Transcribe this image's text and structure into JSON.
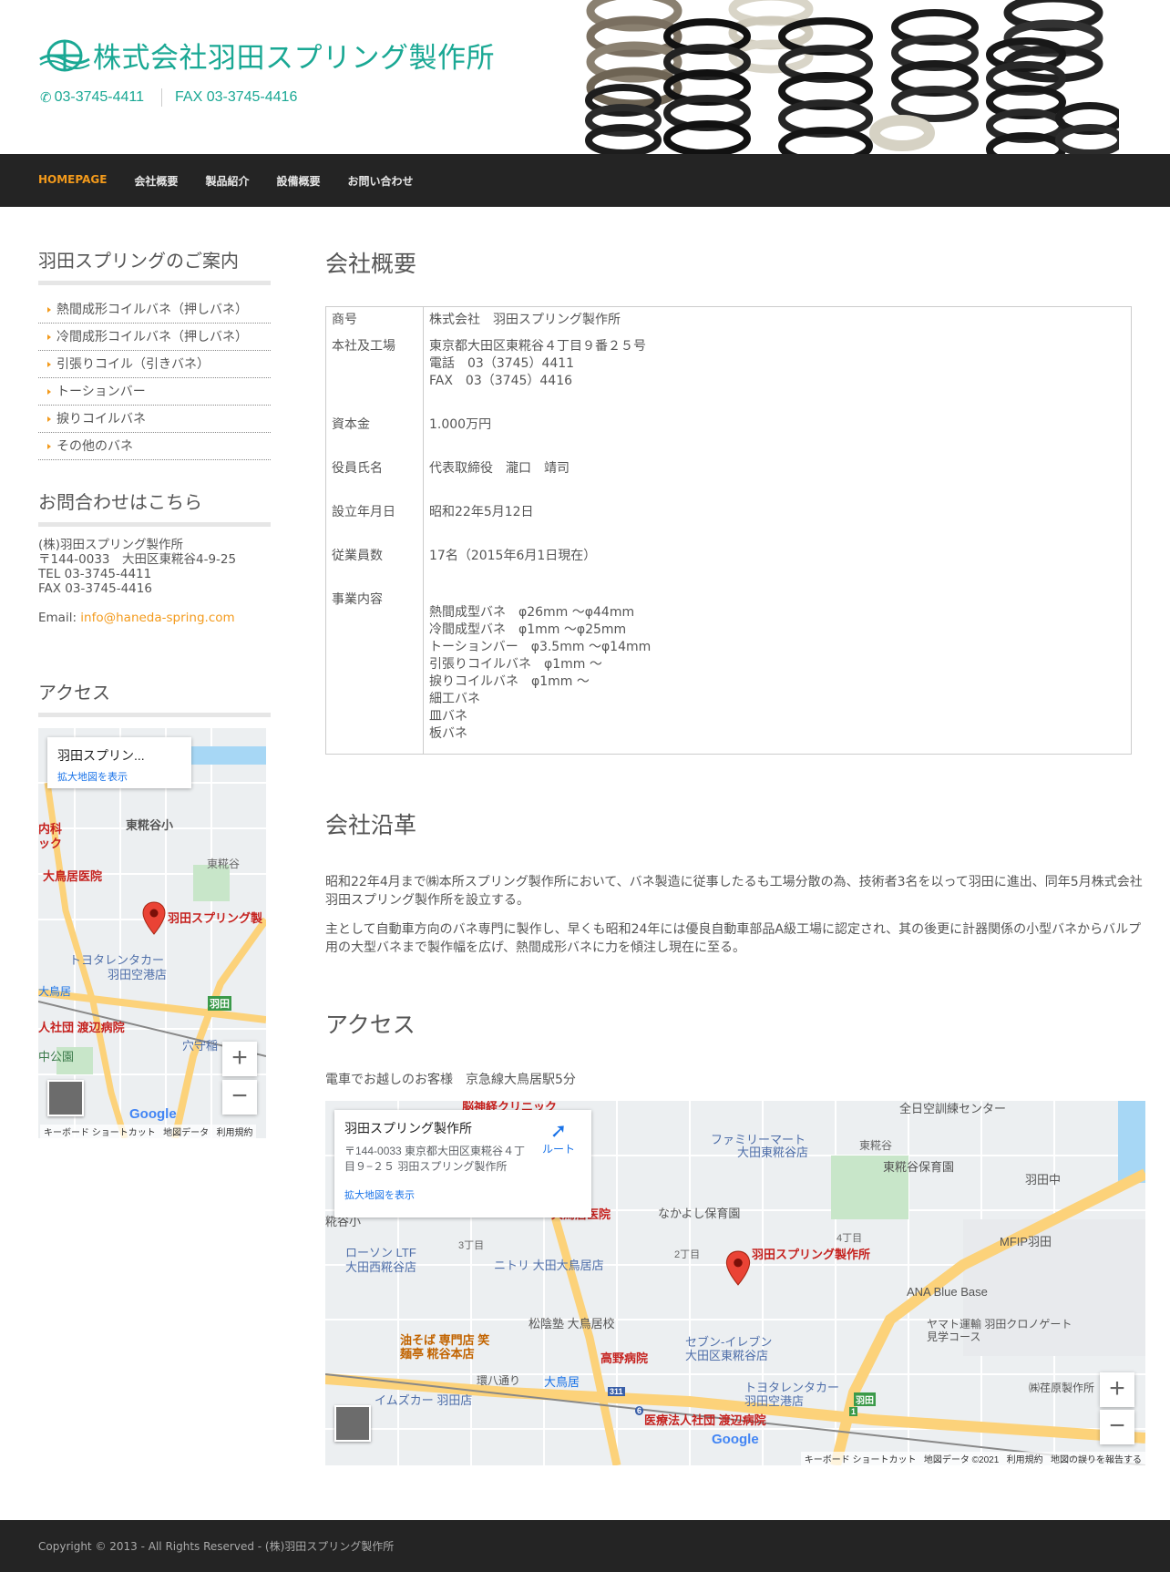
{
  "header": {
    "site_title": "株式会社羽田スプリング製作所",
    "phone": "03-3745-4411",
    "fax": "FAX 03-3745-4416"
  },
  "nav": {
    "items": [
      "HOMEPAGE",
      "会社概要",
      "製品紹介",
      "設備概要",
      "お問い合わせ"
    ]
  },
  "sidebar": {
    "guide_title": "羽田スプリングのご案内",
    "guide_items": [
      "熱間成形コイルバネ（押しバネ）",
      "冷間成形コイルバネ（押しバネ）",
      "引張りコイル（引きバネ）",
      "トーションバー",
      "捩りコイルバネ",
      "その他のバネ"
    ],
    "contact_title": "お問合わせはこちら",
    "contact_lines": [
      "(株)羽田スプリング製作所",
      "〒144-0033　大田区東糀谷4-9-25",
      "TEL 03-3745-4411",
      "FAX 03-3745-4416"
    ],
    "email_label": "Email: ",
    "email": "info@haneda-spring.com",
    "access_title": "アクセス",
    "map": {
      "place_name": "羽田スプリン...",
      "enlarge_link": "拡大地図を表示",
      "footer": [
        "キーボード ショートカット",
        "地図データ",
        "利用規約"
      ],
      "labels": [
        "東糀谷小",
        "東糀谷",
        "大鳥居医院",
        "羽田スプリング製",
        "トヨタレンタカー",
        "羽田空港店",
        "大鳥居",
        "羽田",
        "人社団 渡辺病院",
        "穴守稲",
        "中公園",
        "内科",
        "ック"
      ]
    }
  },
  "main": {
    "company_heading": "会社概要",
    "table": [
      {
        "label": "商号",
        "lines": [
          "株式会社　羽田スプリング製作所"
        ]
      },
      {
        "label": "本社及工場",
        "lines": [
          "東京都大田区東糀谷４丁目９番２５号",
          "電話　03（3745）4411",
          "FAX　03（3745）4416"
        ]
      },
      {
        "label": "資本金",
        "lines": [
          "1.000万円"
        ]
      },
      {
        "label": "役員氏名",
        "lines": [
          "代表取締役　瀧口　靖司"
        ]
      },
      {
        "label": "設立年月日",
        "lines": [
          "昭和22年5月12日"
        ]
      },
      {
        "label": "従業員数",
        "lines": [
          "17名（2015年6月1日現在）"
        ]
      },
      {
        "label": "事業内容",
        "lines": [
          "熱間成型バネ　φ26mm ～φ44mm",
          "冷間成型バネ　φ1mm ～φ25mm",
          "トーションバー　φ3.5mm ～φ14mm",
          "引張りコイルバネ　φ1mm ～",
          "捩りコイルバネ　φ1mm ～",
          "細工バネ",
          "皿バネ",
          "板バネ"
        ]
      }
    ],
    "history_heading": "会社沿革",
    "history": [
      "昭和22年4月まで㈱本所スプリング製作所において、バネ製造に従事したるも工場分散の為、技術者3名を以って羽田に進出、同年5月株式会社羽田スプリング製作所を設立する。",
      "主として自動車方向のバネ専門に製作し、早くも昭和24年には優良自動車部品A級工場に認定され、其の後更に計器関係の小型バネからバルプ用の大型バネまで製作幅を広げ、熱間成形バネに力を傾注し現在に至る。"
    ],
    "access_heading": "アクセス",
    "access_note": "電車でお越しのお客様　京急線大鳥居駅5分",
    "map": {
      "place_name": "羽田スプリング製作所",
      "address": "〒144-0033 東京都大田区東糀谷４丁目９−２５ 羽田スプリング製作所",
      "route_label": "ルート",
      "enlarge_link": "拡大地図を表示",
      "footer": [
        "キーボード ショートカット",
        "地図データ ©2021",
        "利用規約",
        "地図の誤りを報告する"
      ],
      "labels": [
        "脳神経クリニック",
        "全日空訓練センター",
        "ファミリーマート",
        "大田東糀谷店",
        "東糀谷",
        "東糀谷保育園",
        "羽田中",
        "糀谷小",
        "大鳥居医院",
        "なかよし保育園",
        "4丁目",
        "MFIP羽田",
        "ローソン LTF",
        "大田西糀谷店",
        "3丁目",
        "ニトリ 大田大鳥居店",
        "2丁目",
        "羽田スプリング製作所",
        "ANA Blue Base",
        "松陰塾 大鳥居校",
        "ヤマト運輸 羽田クロノゲート 見学コース",
        "油そば 専門店 笑",
        "麺亭 糀谷本店",
        "セブン-イレブン",
        "大田区東糀谷店",
        "高野病院",
        "環八通り",
        "大鳥居",
        "トヨタレンタカー",
        "羽田空港店",
        "㈱荏原製作所",
        "イムズカー 羽田店",
        "医療法人社団 渡辺病院",
        "羽田",
        "311",
        "6",
        "1"
      ]
    }
  },
  "footer": {
    "copyright": "Copyright © 2013 - All Rights Reserved - (株)羽田スプリング製作所"
  },
  "colors": {
    "brand_teal": "#1aa894",
    "accent_orange": "#f39a1b",
    "nav_bg": "#242424",
    "map_pin_red": "#ea4335"
  }
}
